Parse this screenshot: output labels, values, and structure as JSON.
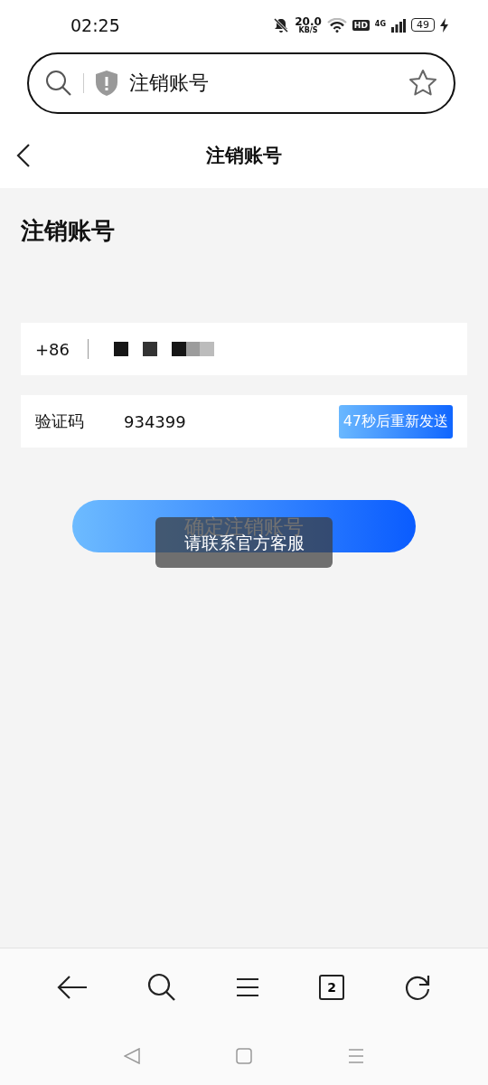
{
  "status_bar": {
    "time": "02:25",
    "speed": "20.0",
    "speed_unit": "KB/S",
    "hd": "HD",
    "network": "4G",
    "battery": "49"
  },
  "address_bar": {
    "title": "注销账号"
  },
  "header": {
    "title": "注销账号"
  },
  "page": {
    "heading": "注销账号",
    "phone": {
      "country_code": "+86"
    },
    "code": {
      "label": "验证码",
      "value": "934399",
      "resend": "47秒后重新发送"
    },
    "confirm_button": "确定注销账号",
    "toast": "请联系官方客服"
  },
  "toolbar": {
    "tab_count": "2"
  }
}
